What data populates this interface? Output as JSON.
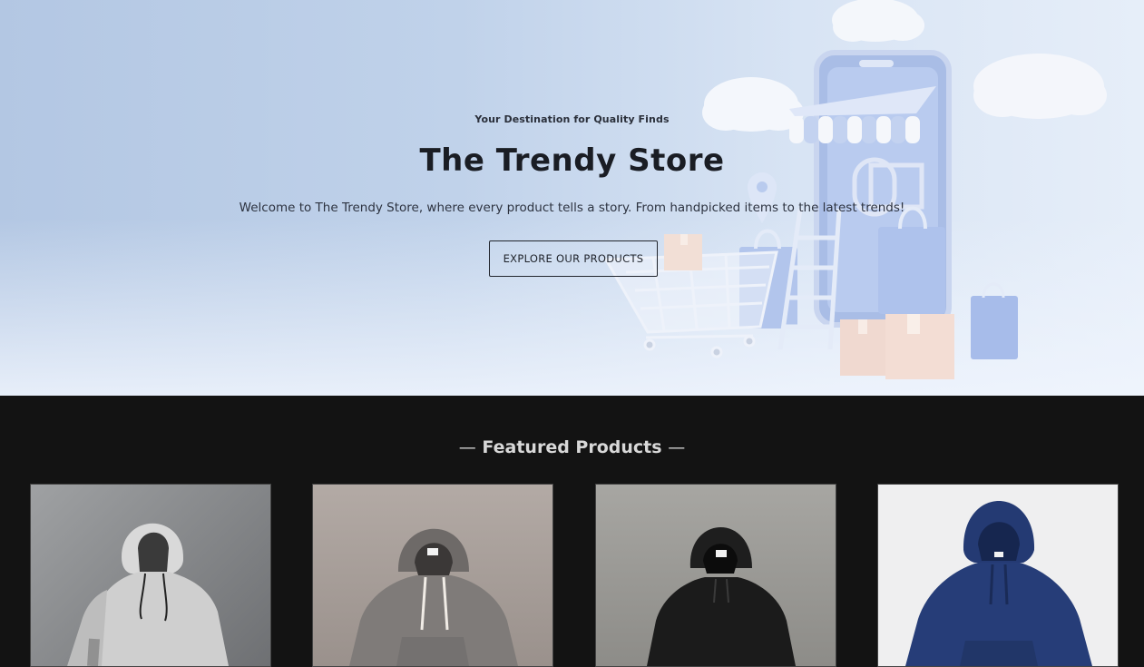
{
  "hero": {
    "eyebrow": "Your Destination for Quality Finds",
    "title": "The Trendy Store",
    "description": "Welcome to The Trendy Store, where every product tells a story. From handpicked items to the latest trends!",
    "cta_label": "EXPLORE OUR PRODUCTS",
    "illustration": "shopping-illustration"
  },
  "featured": {
    "dash": "—",
    "heading": "Featured Products",
    "products": [
      {
        "image": "light-grey-hoodie",
        "color": "#d9d9d9"
      },
      {
        "image": "grey-hoodie",
        "color": "#7f7b79"
      },
      {
        "image": "black-hoodie",
        "color": "#1b1b1b"
      },
      {
        "image": "navy-hoodie",
        "color": "#243a73"
      }
    ]
  },
  "colors": {
    "hero_bg": "#c0d2ea",
    "section_bg": "#131313",
    "heading_text": "#d8d8d8"
  }
}
